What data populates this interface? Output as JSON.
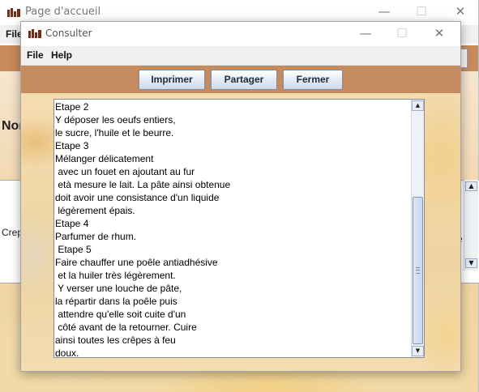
{
  "background_window": {
    "title": "Page d'accueil",
    "menu": {
      "file": "File"
    },
    "heading": "Nom",
    "cell_left": "Crep",
    "cell_right": "e"
  },
  "dialog": {
    "title": "Consulter",
    "menu": {
      "file": "File",
      "help": "Help"
    },
    "buttons": {
      "print": "Imprimer",
      "share": "Partager",
      "close": "Fermer"
    },
    "recipe_text": "Etape 2\nY déposer les oeufs entiers,\nle sucre, l'huile et le beurre.\nEtape 3\nMélanger délicatement\n avec un fouet en ajoutant au fur\n età mesure le lait. La pâte ainsi obtenue\ndoit avoir une consistance d'un liquide\n légèrement épais.\nEtape 4\nParfumer de rhum.\n Etape 5\nFaire chauffer une poêle antiadhésive\n et la huiler très légèrement.\n Y verser une louche de pâte,\nla répartir dans la poêle puis\n attendre qu'elle soit cuite d'un\n côté avant de la retourner. Cuire\nainsi toutes les crêpes à feu\ndoux."
  },
  "icons": {
    "app": "app-logo-icon",
    "minimize": "minimize-icon",
    "maximize": "maximize-icon",
    "close": "close-icon",
    "scroll_up": "scroll-up-arrow-icon",
    "scroll_down": "scroll-down-arrow-icon"
  },
  "colors": {
    "toolbar_band": "#c48b5f",
    "button_text": "#1c2b3d",
    "button_border": "#7a8ea8"
  }
}
